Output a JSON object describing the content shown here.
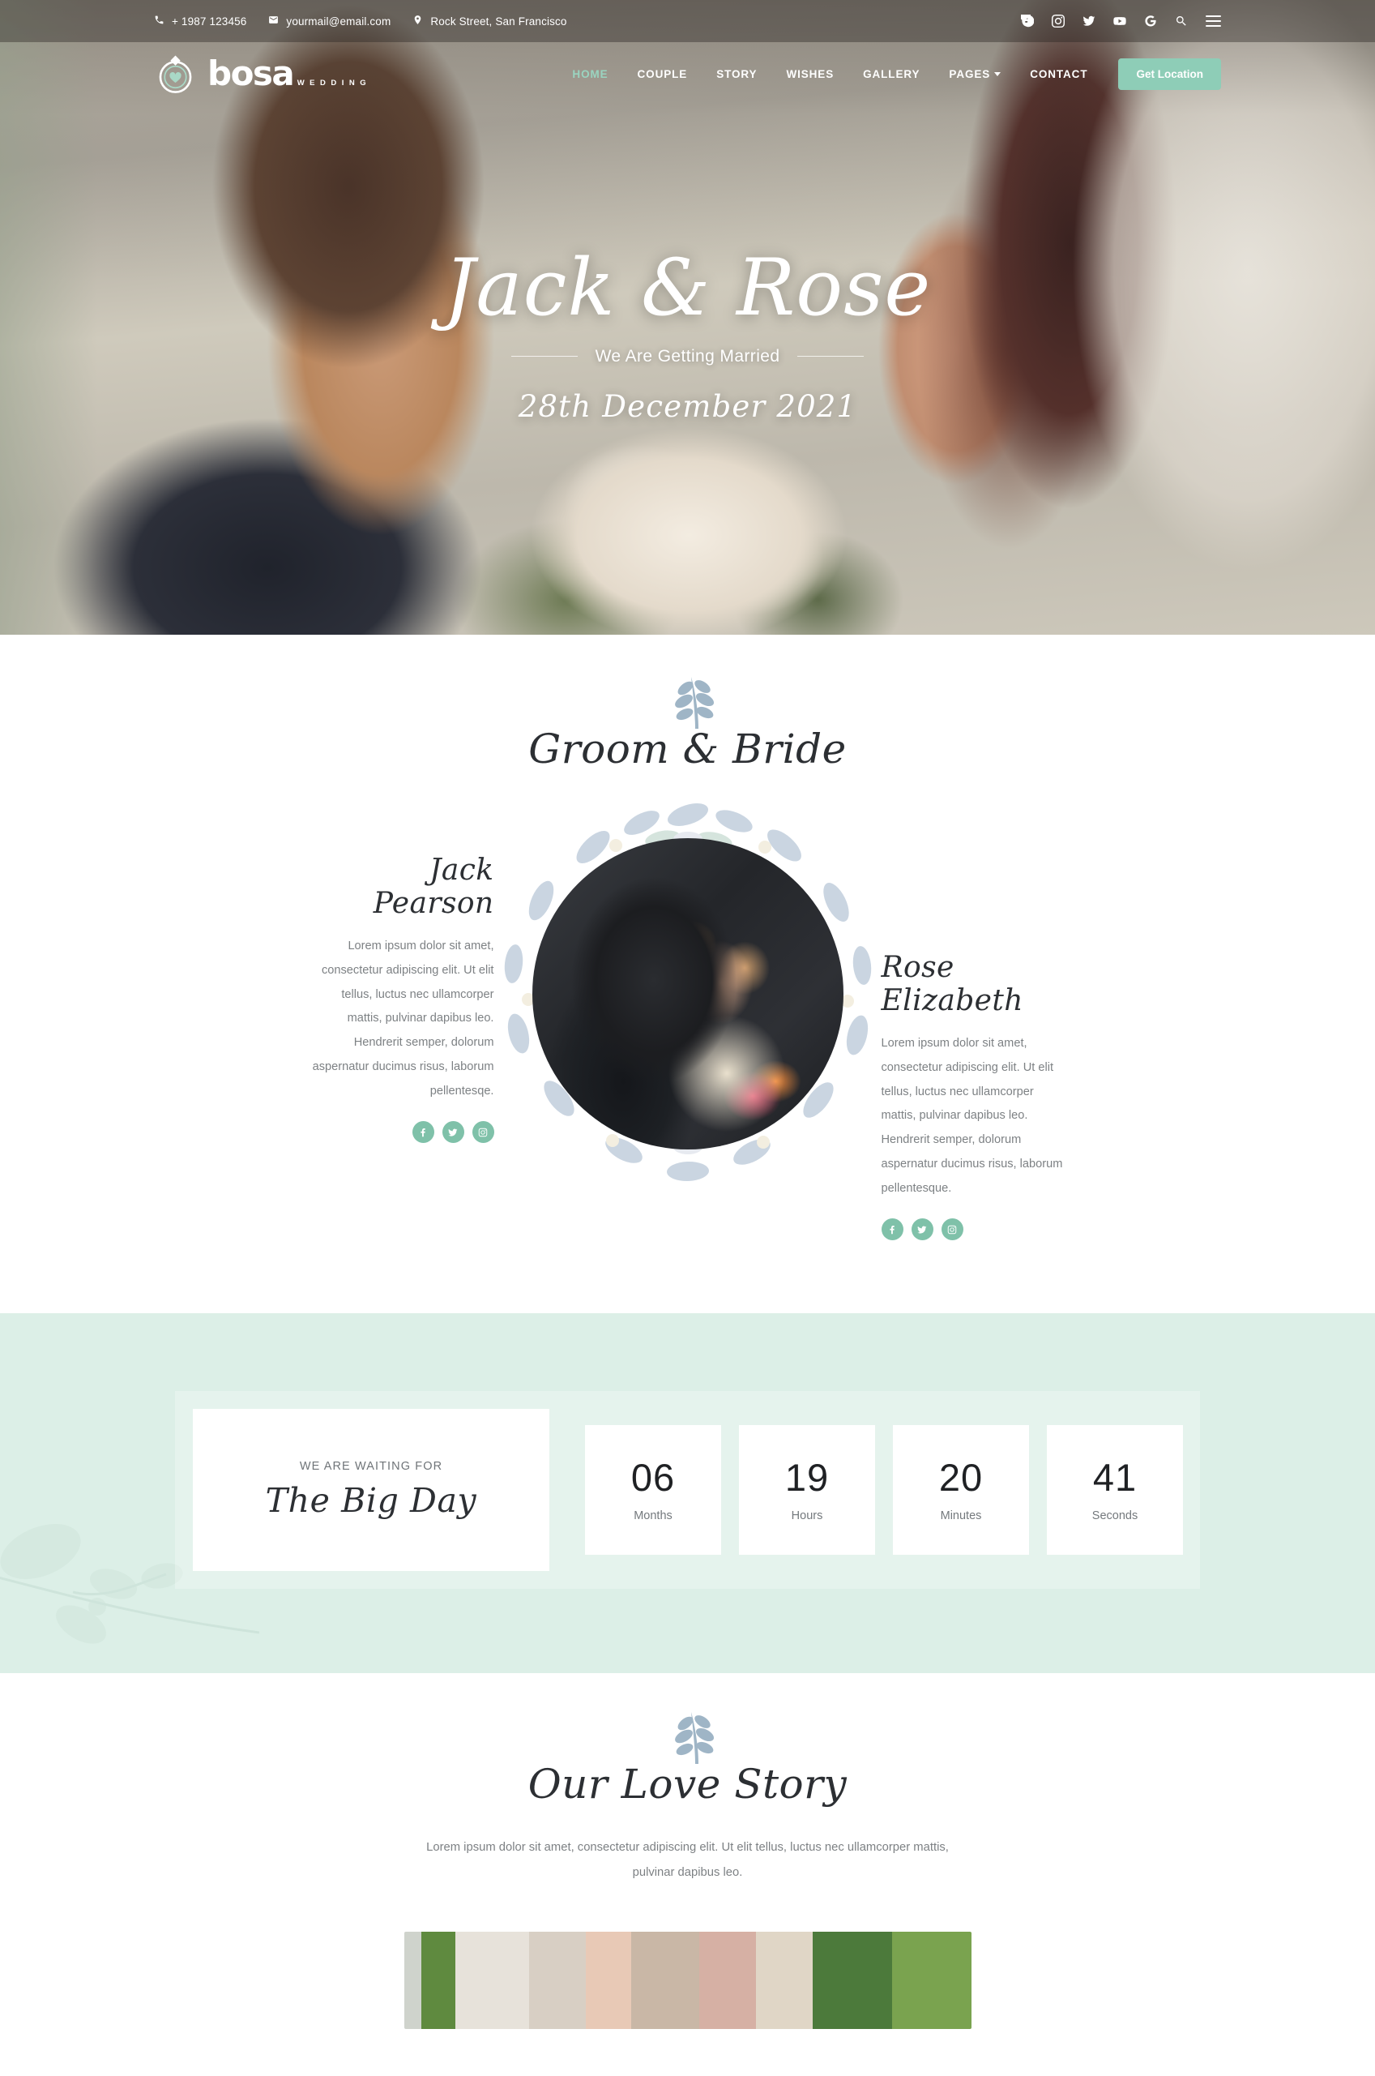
{
  "topbar": {
    "phone": "+ 1987 123456",
    "email": "yourmail@email.com",
    "address": "Rock Street, San Francisco",
    "icons": {
      "phone": "phone-icon",
      "email": "envelope-icon",
      "address": "map-pin-icon"
    },
    "socials": [
      {
        "name": "facebook-icon",
        "label": "Facebook"
      },
      {
        "name": "instagram-icon",
        "label": "Instagram"
      },
      {
        "name": "twitter-icon",
        "label": "Twitter"
      },
      {
        "name": "youtube-icon",
        "label": "YouTube"
      },
      {
        "name": "google-icon",
        "label": "Google"
      },
      {
        "name": "search-icon",
        "label": "Search"
      }
    ],
    "menu_toggle": "hamburger-menu-icon"
  },
  "brand": {
    "name": "bosa",
    "tagline": "WEDDING",
    "mark": "wedding-ring-heart-icon"
  },
  "nav": {
    "items": [
      {
        "label": "HOME",
        "active": true,
        "dropdown": false
      },
      {
        "label": "COUPLE",
        "active": false,
        "dropdown": false
      },
      {
        "label": "STORY",
        "active": false,
        "dropdown": false
      },
      {
        "label": "WISHES",
        "active": false,
        "dropdown": false
      },
      {
        "label": "GALLERY",
        "active": false,
        "dropdown": false
      },
      {
        "label": "PAGES",
        "active": false,
        "dropdown": true
      },
      {
        "label": "CONTACT",
        "active": false,
        "dropdown": false
      }
    ],
    "cta_label": "Get Location",
    "cta_color": "#8ecdb7"
  },
  "hero": {
    "names": "Jack & Rose",
    "subtitle": "We Are Getting Married",
    "date": "28th December 2021"
  },
  "couple": {
    "heading": "Groom & Bride",
    "groom": {
      "name": "Jack Pearson",
      "bio": "Lorem ipsum dolor sit amet, consectetur adipiscing elit. Ut elit tellus, luctus nec ullamcorper mattis, pulvinar dapibus leo. Hendrerit semper, dolorum aspernatur ducimus risus,  laborum pellentesqe.",
      "socials": [
        "facebook-icon",
        "twitter-icon",
        "instagram-icon"
      ]
    },
    "bride": {
      "name": "Rose Elizabeth",
      "bio": "Lorem ipsum dolor sit amet, consectetur adipiscing elit. Ut elit tellus, luctus nec ullamcorper mattis, pulvinar dapibus leo. Hendrerit semper, dolorum aspernatur ducimus risus,  laborum pellentesque.",
      "socials": [
        "facebook-icon",
        "twitter-icon",
        "instagram-icon"
      ]
    },
    "photo_alt": "couple-portrait",
    "social_color": "#7fc1a9"
  },
  "countdown": {
    "kicker": "WE ARE WAITING FOR",
    "title": "The Big Day",
    "background": "#dcefe7",
    "units": [
      {
        "value": "06",
        "label": "Months"
      },
      {
        "value": "19",
        "label": "Hours"
      },
      {
        "value": "20",
        "label": "Minutes"
      },
      {
        "value": "41",
        "label": "Seconds"
      }
    ]
  },
  "story": {
    "heading": "Our Love Story",
    "description": "Lorem ipsum dolor sit amet, consectetur adipiscing elit. Ut elit tellus, luctus nec ullamcorper mattis, pulvinar dapibus leo."
  }
}
